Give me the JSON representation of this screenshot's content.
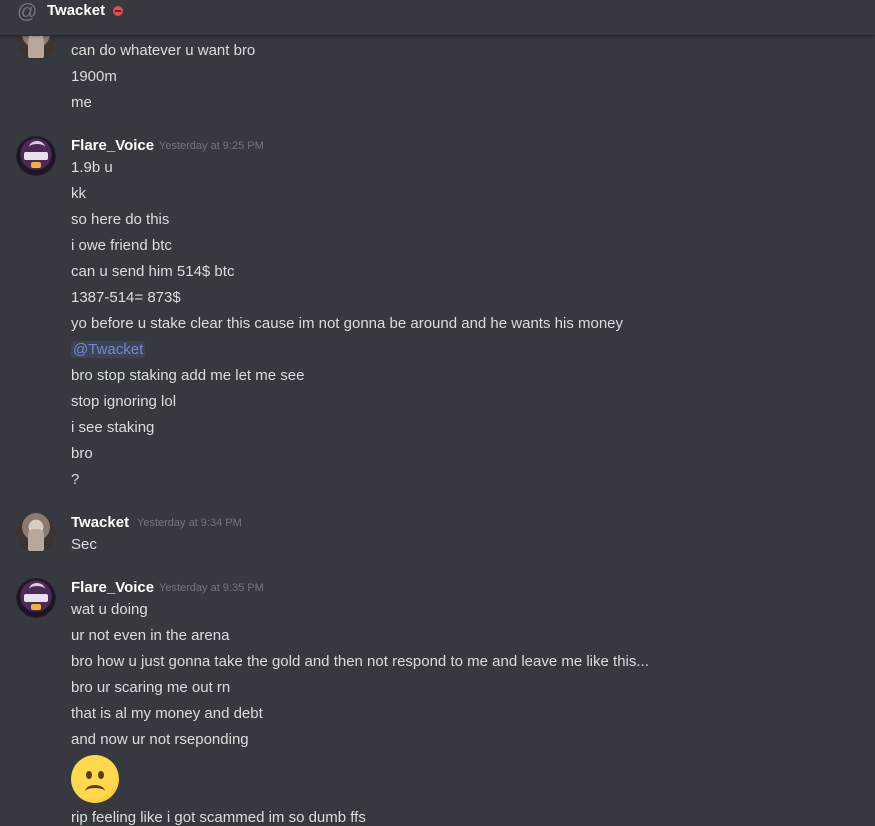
{
  "header": {
    "icon": "at-icon",
    "channel": "Twacket",
    "status_color": "#f04747"
  },
  "groups": [
    {
      "id": "g0",
      "author": "",
      "time": "",
      "lines": [
        "can do whatever u want bro",
        "1900m",
        "me"
      ]
    },
    {
      "id": "g1",
      "author": "Flare_Voice",
      "time": "Yesterday at 9:25 PM",
      "lines": [
        "1.9b u",
        "kk",
        "so here do this",
        "i owe friend btc",
        "can u send him 514$ btc",
        "1387-514= 873$",
        "yo before u stake clear this cause im not gonna be around and he wants his money",
        "@Twacket",
        "bro stop staking add me let me see",
        "stop ignoring lol",
        "i see staking",
        "bro",
        "?"
      ]
    },
    {
      "id": "g2",
      "author": "Twacket",
      "time": "Yesterday at 9:34 PM",
      "lines": [
        "Sec"
      ]
    },
    {
      "id": "g3",
      "author": "Flare_Voice",
      "time": "Yesterday at 9:35 PM",
      "lines": [
        "wat u doing",
        "ur not even in the arena",
        "bro how u just gonna take the gold and then not respond to me and leave me like this...",
        "bro ur scaring me out rn",
        "that is al my money and debt",
        "and now ur not rseponding",
        "rip feeling like i got scammed im so dumb ffs"
      ],
      "emoji": "frowning-face-emoji"
    }
  ]
}
